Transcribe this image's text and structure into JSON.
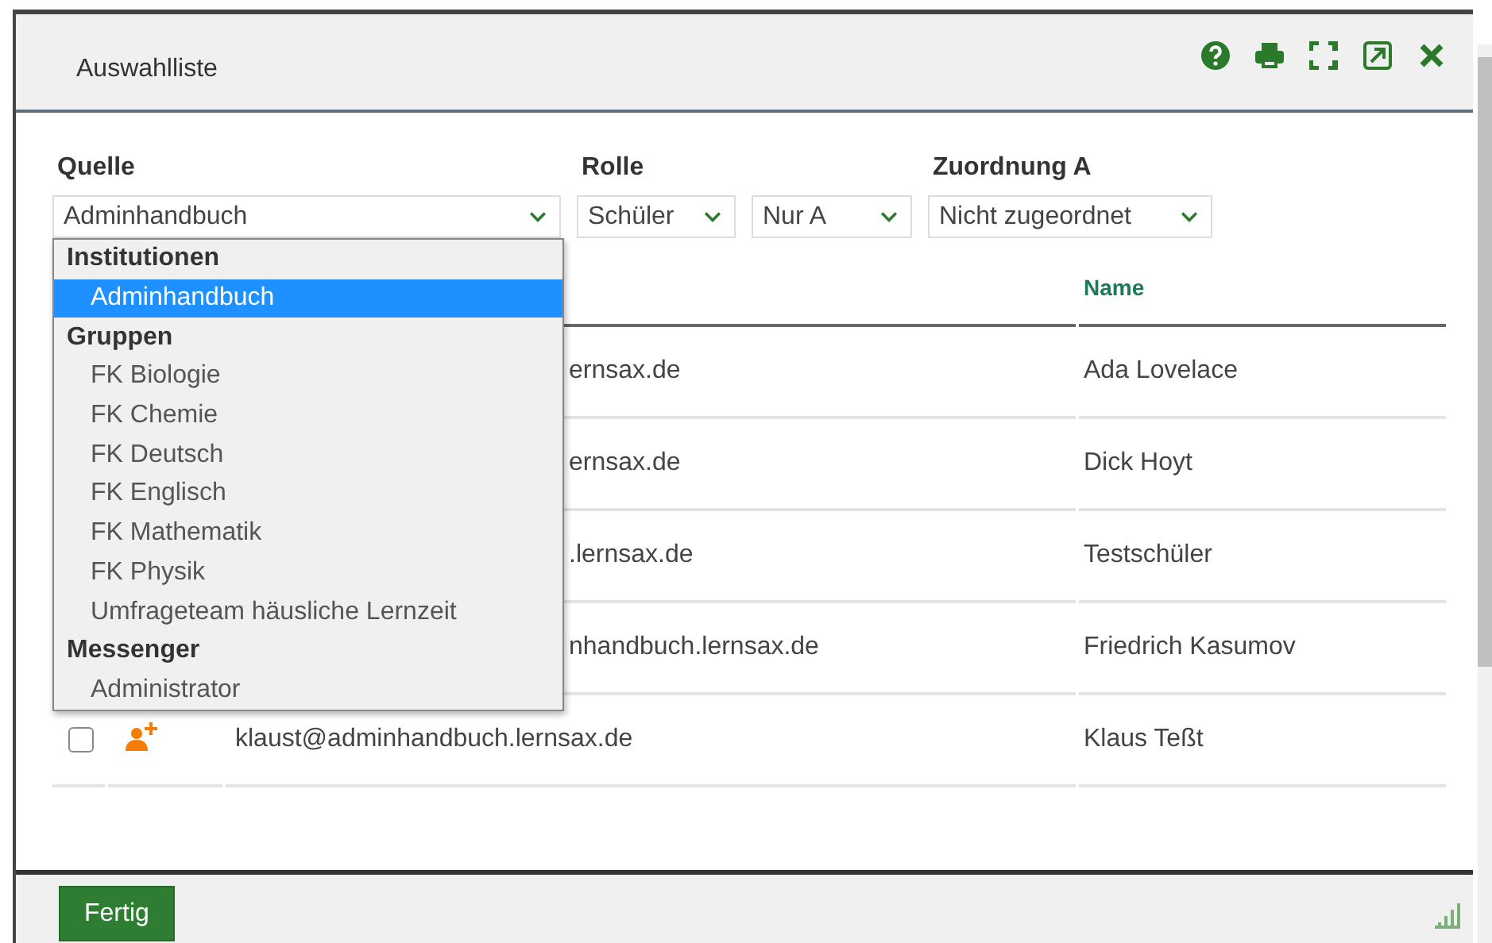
{
  "window": {
    "title": "Auswahlliste"
  },
  "filters": [
    {
      "label": "Quelle",
      "selects": [
        "Adminhandbuch"
      ]
    },
    {
      "label": "Rolle",
      "selects": [
        "Schüler",
        "Nur A"
      ]
    },
    {
      "label": "Zuordnung A",
      "selects": [
        "Nicht zugeordnet"
      ]
    }
  ],
  "dropdown": {
    "items": [
      {
        "kind": "group",
        "label": "Institutionen"
      },
      {
        "kind": "option",
        "label": "Adminhandbuch",
        "selected": true
      },
      {
        "kind": "group",
        "label": "Gruppen"
      },
      {
        "kind": "option",
        "label": "FK Biologie",
        "selected": false
      },
      {
        "kind": "option",
        "label": "FK Chemie",
        "selected": false
      },
      {
        "kind": "option",
        "label": "FK Deutsch",
        "selected": false
      },
      {
        "kind": "option",
        "label": "FK Englisch",
        "selected": false
      },
      {
        "kind": "option",
        "label": "FK Mathematik",
        "selected": false
      },
      {
        "kind": "option",
        "label": "FK Physik",
        "selected": false
      },
      {
        "kind": "option",
        "label": "Umfrageteam häusliche Lernzeit",
        "selected": false
      },
      {
        "kind": "group",
        "label": "Messenger"
      },
      {
        "kind": "option",
        "label": "Administrator",
        "selected": false
      }
    ]
  },
  "table": {
    "name_header": "Name",
    "rows": [
      {
        "kind": "covered",
        "email": "ernsax.de",
        "name": "Ada Lovelace"
      },
      {
        "kind": "covered",
        "email": "ernsax.de",
        "name": "Dick Hoyt"
      },
      {
        "kind": "covered",
        "email": ".lernsax.de",
        "name": "Testschüler"
      },
      {
        "kind": "covered",
        "email": "nhandbuch.lernsax.de",
        "name": "Friedrich Kasumov"
      },
      {
        "kind": "full",
        "checked": false,
        "email": "klaust@adminhandbuch.lernsax.de",
        "name": "Klaus Teßt"
      }
    ]
  },
  "footer": {
    "button": "Fertig"
  }
}
